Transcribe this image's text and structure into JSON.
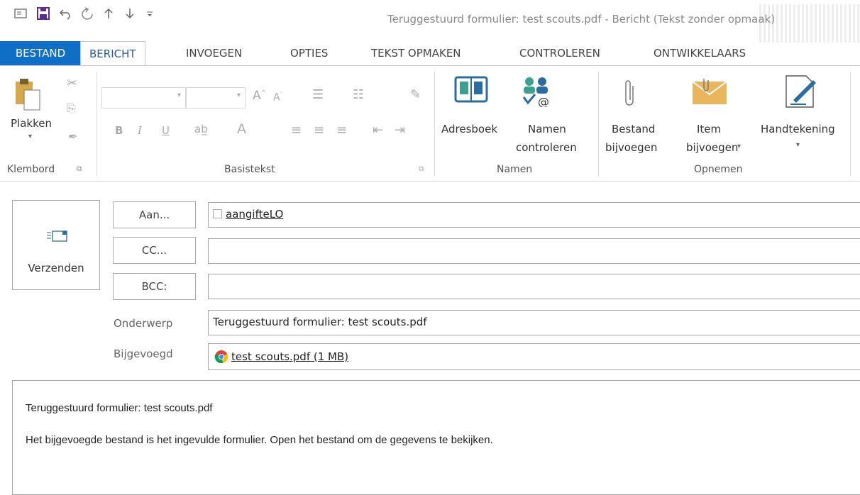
{
  "window": {
    "title": "Teruggestuurd formulier: test scouts.pdf - Bericht (Tekst zonder opmaak)"
  },
  "quick_access": [
    "email-icon",
    "save-icon",
    "undo-icon",
    "redo-icon",
    "up-icon",
    "down-icon",
    "customize-icon"
  ],
  "tabs": {
    "file": "BESTAND",
    "items": [
      "BERICHT",
      "INVOEGEN",
      "OPTIES",
      "TEKST OPMAKEN",
      "CONTROLEREN",
      "ONTWIKKELAARS"
    ]
  },
  "ribbon": {
    "clipboard": {
      "paste": "Plakken",
      "group": "Klembord"
    },
    "basic_text": {
      "group": "Basistekst",
      "bold": "B",
      "italic": "I",
      "underline": "U",
      "font_color_letter": "A"
    },
    "names": {
      "address_book": "Adresboek",
      "check_names_1": "Namen",
      "check_names_2": "controleren",
      "group": "Namen"
    },
    "include": {
      "attach_file_1": "Bestand",
      "attach_file_2": "bijvoegen",
      "attach_item_1": "Item",
      "attach_item_2": "bijvoegen",
      "signature": "Handtekening",
      "group": "Opnemen"
    }
  },
  "compose": {
    "send": "Verzenden",
    "to_button": "Aan...",
    "cc_button": "CC...",
    "bcc_button": "BCC:",
    "to_value": "aangifteLO",
    "subject_label": "Onderwerp",
    "subject_value": "Teruggestuurd formulier: test scouts.pdf",
    "attached_label": "Bijgevoegd",
    "attachment": "test scouts.pdf (1 MB)"
  },
  "body": {
    "line1": "Teruggestuurd formulier: test scouts.pdf",
    "line2": "Het bijgevoegde bestand is het ingevulde formulier. Open het bestand om de gegevens te bekijken."
  },
  "colors": {
    "accent": "#0f6fc6",
    "active_tab_text": "#2b5797",
    "save_purple": "#5c2d91"
  }
}
